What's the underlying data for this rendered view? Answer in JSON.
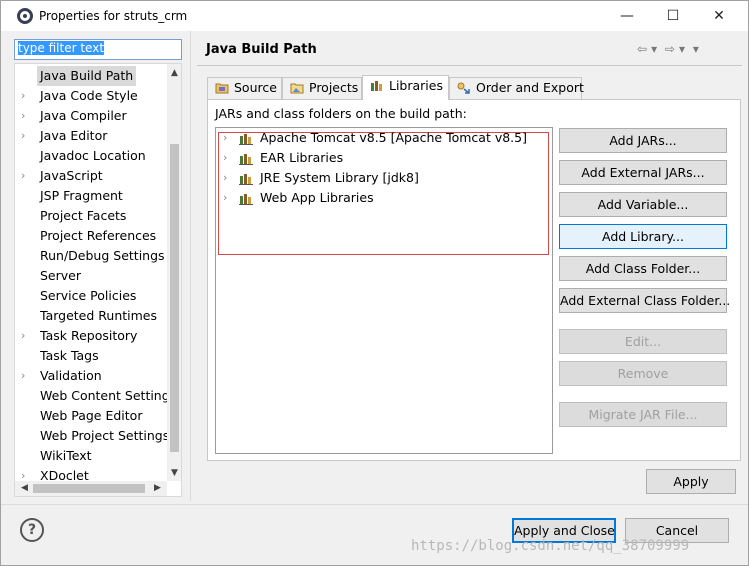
{
  "window": {
    "title": "Properties for struts_crm",
    "min_glyph": "—",
    "max_glyph": "☐",
    "close_glyph": "✕"
  },
  "filter": {
    "value": "type filter text"
  },
  "tree": {
    "items": [
      {
        "label": "Java Build Path",
        "expandable": false,
        "selected": true
      },
      {
        "label": "Java Code Style",
        "expandable": true
      },
      {
        "label": "Java Compiler",
        "expandable": true
      },
      {
        "label": "Java Editor",
        "expandable": true
      },
      {
        "label": "Javadoc Location",
        "expandable": false
      },
      {
        "label": "JavaScript",
        "expandable": true
      },
      {
        "label": "JSP Fragment",
        "expandable": false
      },
      {
        "label": "Project Facets",
        "expandable": false
      },
      {
        "label": "Project References",
        "expandable": false
      },
      {
        "label": "Run/Debug Settings",
        "expandable": false
      },
      {
        "label": "Server",
        "expandable": false
      },
      {
        "label": "Service Policies",
        "expandable": false
      },
      {
        "label": "Targeted Runtimes",
        "expandable": false
      },
      {
        "label": "Task Repository",
        "expandable": true
      },
      {
        "label": "Task Tags",
        "expandable": false
      },
      {
        "label": "Validation",
        "expandable": true
      },
      {
        "label": "Web Content Settings",
        "expandable": false
      },
      {
        "label": "Web Page Editor",
        "expandable": false
      },
      {
        "label": "Web Project Settings",
        "expandable": false
      },
      {
        "label": "WikiText",
        "expandable": false
      },
      {
        "label": "XDoclet",
        "expandable": true
      }
    ]
  },
  "page": {
    "title": "Java Build Path",
    "tabs": [
      "Source",
      "Projects",
      "Libraries",
      "Order and Export"
    ],
    "active_tab": "Libraries",
    "jars_label": "JARs and class folders on the build path:",
    "libraries": [
      "Apache Tomcat v8.5 [Apache Tomcat v8.5]",
      "EAR Libraries",
      "JRE System Library [jdk8]",
      "Web App Libraries"
    ],
    "buttons": {
      "add_jars": "Add JARs...",
      "add_external_jars": "Add External JARs...",
      "add_variable": "Add Variable...",
      "add_library": "Add Library...",
      "add_class_folder": "Add Class Folder...",
      "add_external_class_folder": "Add External Class Folder...",
      "edit": "Edit...",
      "remove": "Remove",
      "migrate_jar": "Migrate JAR File..."
    },
    "apply": "Apply"
  },
  "footer": {
    "help": "?",
    "apply_and_close": "Apply and Close",
    "cancel": "Cancel"
  },
  "watermark": "https://blog.csdn.net/qq_38709999"
}
